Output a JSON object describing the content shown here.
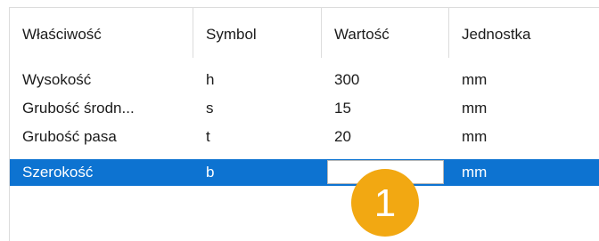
{
  "columns": {
    "property": "Właściwość",
    "symbol": "Symbol",
    "value": "Wartość",
    "unit": "Jednostka"
  },
  "rows": [
    {
      "property": "Wysokość",
      "symbol": "h",
      "value": "300",
      "unit": "mm"
    },
    {
      "property": "Grubość środn...",
      "symbol": "s",
      "value": "15",
      "unit": "mm"
    },
    {
      "property": "Grubość pasa",
      "symbol": "t",
      "value": "20",
      "unit": "mm"
    },
    {
      "property": "Szerokość",
      "symbol": "b",
      "value": "",
      "unit": "mm",
      "selected": true
    }
  ],
  "callout": {
    "number": "1"
  },
  "colors": {
    "selection": "#0d73d1",
    "callout": "#f2a812"
  }
}
